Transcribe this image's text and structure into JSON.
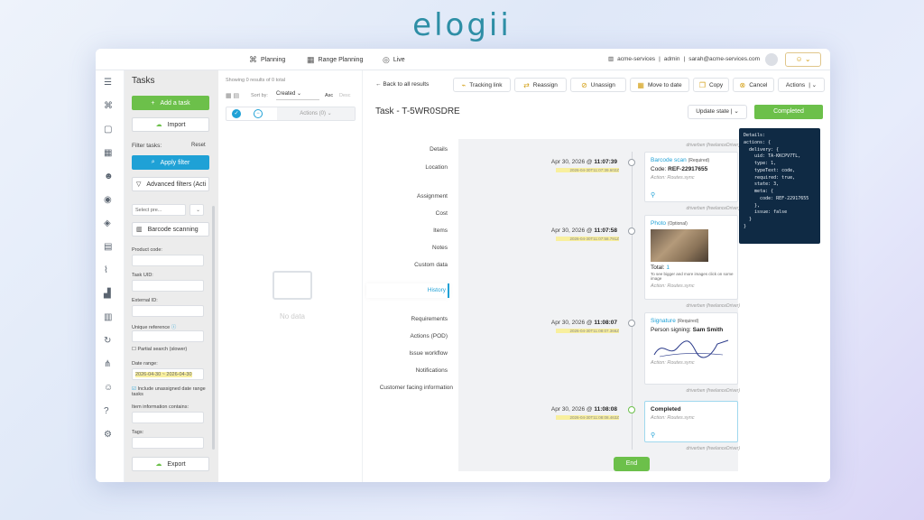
{
  "brand": {
    "logo_text": "elogii"
  },
  "topbar": {
    "nav": [
      {
        "label": "Planning"
      },
      {
        "label": "Range Planning"
      },
      {
        "label": "Live"
      }
    ],
    "account": "acme-services",
    "role": "admin",
    "email": "sarah@acme-services.com"
  },
  "sidebar": {
    "title": "Tasks",
    "add_task": "Add a task",
    "import": "Import",
    "filter_tasks": "Filter tasks:",
    "reset": "Reset",
    "apply_filter": "Apply filter",
    "advanced_filters": "Advanced filters (Acti",
    "select_placeholder": "Select pre...",
    "barcode_scanning": "Barcode scanning",
    "product_code": "Product code:",
    "task_uid": "Task UID:",
    "external_id": "External ID:",
    "unique_reference": "Unique reference",
    "partial_search": "Partial search (slower)",
    "date_range": "Date range:",
    "date_range_value": "2026-04-30 ~ 2026-04-30",
    "include_unassigned": "Include unassigned date range tasks",
    "item_info": "Item information contains:",
    "tags": "Tags:",
    "export": "Export"
  },
  "list": {
    "showing": "Showing 0 results of 0 total",
    "sort_by": "Sort by:",
    "sort_value": "Created",
    "order": "Asc",
    "desc": "Desc",
    "actions": "Actions (0)",
    "no_data": "No data"
  },
  "detail": {
    "back": "Back to all results",
    "toolbar": [
      {
        "label": "Tracking link"
      },
      {
        "label": "Reassign"
      },
      {
        "label": "Unassign"
      },
      {
        "label": "Move to date"
      },
      {
        "label": "Copy"
      },
      {
        "label": "Cancel"
      },
      {
        "label": "Actions"
      }
    ],
    "title": "Task - T-5WR0SDRE",
    "update_state": "Update state",
    "completed": "Completed",
    "sections": [
      "Details",
      "Location",
      "Assignment",
      "Cost",
      "Items",
      "Notes",
      "Custom data",
      "History",
      "Requirements",
      "Actions (POD)",
      "Issue workflow",
      "Notifications",
      "Customer facing information"
    ],
    "end": "End"
  },
  "timeline": [
    {
      "date": "Apr 30, 2026 @",
      "time": "11:07:39",
      "stamp": "2026-04-30T11:07:39.602Z",
      "title": "Barcode scan",
      "tag": "(Required)",
      "line": "Code:",
      "value": "REF-22917655",
      "action": "Action: Routes.sync",
      "by": "driverben (freelanceDriver)"
    },
    {
      "date": "Apr 30, 2026 @",
      "time": "11:07:58",
      "stamp": "2026-04-30T11:07:58.791Z",
      "title": "Photo",
      "tag": "(Optional)",
      "line": "Total:",
      "value": "1",
      "note": "To see bigger and more images click on some image",
      "action": "Action: Routes.sync",
      "by": "driverben (freelanceDriver)"
    },
    {
      "date": "Apr 30, 2026 @",
      "time": "11:08:07",
      "stamp": "2026-04-30T11:08:07.366Z",
      "title": "Signature",
      "tag": "(Required)",
      "line": "Person signing:",
      "value": "Sam Smith",
      "action": "Action: Routes.sync",
      "by": "driverben (freelanceDriver)"
    },
    {
      "date": "Apr 30, 2026 @",
      "time": "11:08:08",
      "stamp": "2026-04-30T11:08:08.463Z",
      "title": "Completed",
      "action": "Action: Routes.sync",
      "by": "driverben (freelanceDriver)"
    }
  ],
  "json_popup": "Details:\nactions: {\n  delivery: {\n    uid: TA-KKCPV7TL,\n    type: 1,\n    typeText: code,\n    required: true,\n    state: 3,\n    meta: {\n      code: REF-22917655\n    },\n    issue: false\n  }\n}",
  "colors": {
    "brand": "#2e8fa6",
    "green": "#6cc04a",
    "blue": "#1fa1d6",
    "gold": "#d4a017"
  }
}
